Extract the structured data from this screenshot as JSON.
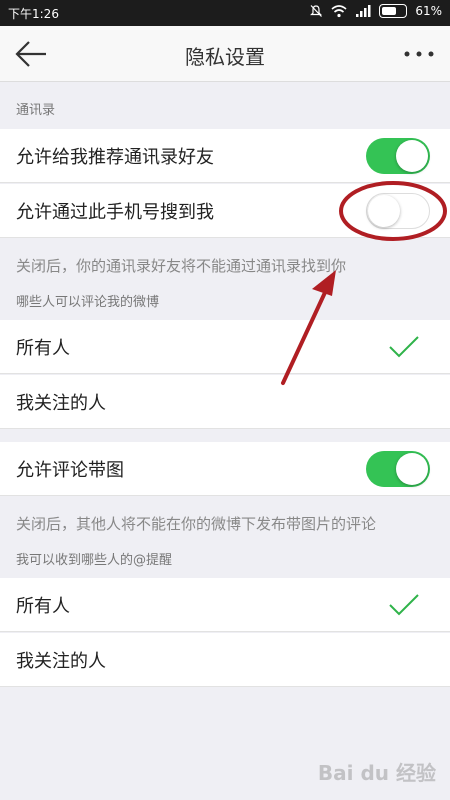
{
  "status_bar": {
    "time": "下午1:26",
    "battery": "61%",
    "battery_level": 0.61,
    "icons": [
      "mute-bell-icon",
      "wifi-icon",
      "signal-icon",
      "battery-icon"
    ]
  },
  "nav": {
    "title": "隐私设置",
    "back_icon": "back-arrow-icon",
    "more_icon": "more-icon"
  },
  "sections": {
    "contacts_header": "通讯录",
    "recommend_contacts": {
      "label": "允许给我推荐通讯录好友",
      "on": true
    },
    "search_by_phone": {
      "label": "允许通过此手机号搜到我",
      "on": false
    },
    "search_note": "关闭后，你的通讯录好友将不能通过通讯录找到你",
    "comment_header": "哪些人可以评论我的微博",
    "comment_options": [
      "所有人",
      "我关注的人"
    ],
    "comment_selected": 0,
    "comment_images": {
      "label": "允许评论带图",
      "on": true
    },
    "images_note": "关闭后，其他人将不能在你的微博下发布带图片的评论",
    "mention_header": "我可以收到哪些人的@提醒",
    "mention_options": [
      "所有人",
      "我关注的人"
    ],
    "mention_selected": 0
  },
  "colors": {
    "toggle_on": "#34c355",
    "check": "#2fb34a",
    "annotation": "#b01e23"
  },
  "watermark": "Bai du 经验"
}
